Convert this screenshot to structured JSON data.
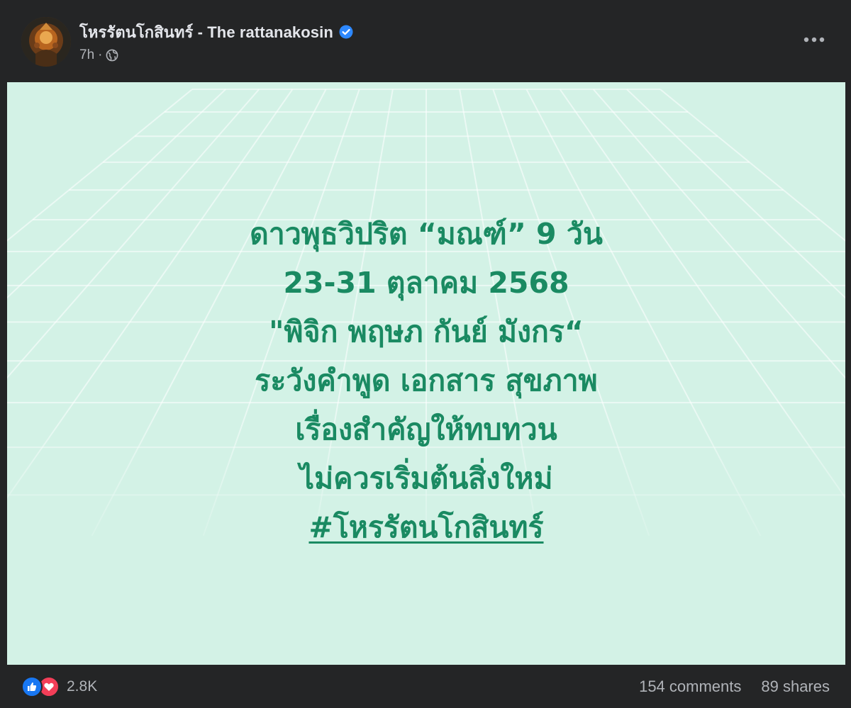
{
  "post": {
    "page_name": "โหรรัตนโกสินทร์ - The rattanakosin",
    "time": "7h",
    "separator": "·",
    "audience_icon": "globe-icon",
    "verified_icon": "verified-badge-icon",
    "more_icon": "more-options-icon"
  },
  "image": {
    "background_color": "#d3f2e6",
    "text_color": "#1a8a62",
    "lines": [
      "ดาวพุธวิปริต “มณฑ์” 9 วัน",
      "23-31 ตุลาคม 2568",
      "\"พิจิก พฤษภ กันย์ มังกร“",
      "ระวังคำพูด เอกสาร สุขภาพ",
      "เรื่องสำคัญให้ทบทวน",
      "ไม่ควรเริ่มต้นสิ่งใหม่"
    ],
    "hashtag": "#โหรรัตนโกสินทร์"
  },
  "footer": {
    "reaction_icons": [
      "like-icon",
      "love-icon"
    ],
    "reaction_count": "2.8K",
    "comments": "154 comments",
    "shares": "89 shares"
  },
  "colors": {
    "background": "#242526",
    "primary_text": "#e4e6eb",
    "secondary_text": "#b0b3b8",
    "verified_blue": "#2d88ff",
    "like_blue": "#1877f2",
    "love_red": "#f33e58"
  }
}
